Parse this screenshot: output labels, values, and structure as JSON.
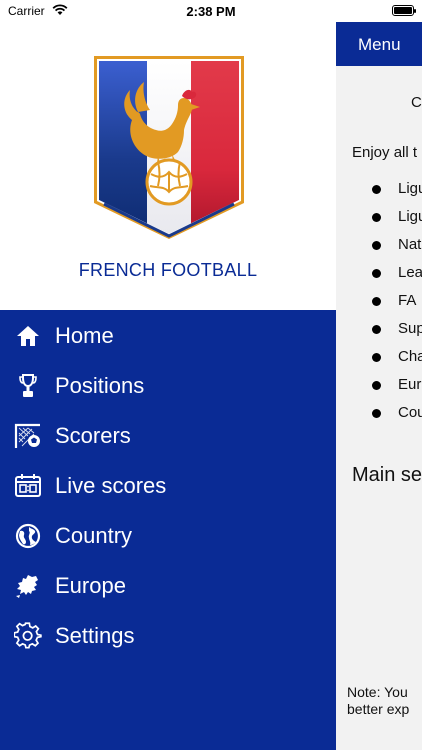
{
  "status_bar": {
    "carrier": "Carrier",
    "time": "2:38 PM"
  },
  "background_screen": {
    "nav_title": "Menu",
    "heading_fragment": "C",
    "intro_fragment": "Enjoy all t",
    "list_fragments": [
      "Ligu",
      "Ligu",
      "Nat",
      "Lea",
      "FA",
      "Sup",
      "Cha",
      "Eur",
      "Cou"
    ],
    "section_fragment": "Main se",
    "note_line1": "Note: You",
    "note_line2": "better exp"
  },
  "drawer": {
    "brand": "FRENCH FOOTBALL",
    "items": [
      {
        "label": "Home",
        "icon": "home-icon"
      },
      {
        "label": "Positions",
        "icon": "trophy-icon"
      },
      {
        "label": "Scorers",
        "icon": "goal-icon"
      },
      {
        "label": "Live scores",
        "icon": "scoreboard-icon"
      },
      {
        "label": "Country",
        "icon": "globe-icon"
      },
      {
        "label": "Europe",
        "icon": "europe-map-icon"
      },
      {
        "label": "Settings",
        "icon": "gear-icon"
      }
    ]
  },
  "colors": {
    "primary_blue": "#0a2b95",
    "crest_blue": "#0d2a6e",
    "crest_red": "#d9283c",
    "crest_gold": "#e29a23",
    "background_content": "#f2f2f2"
  }
}
